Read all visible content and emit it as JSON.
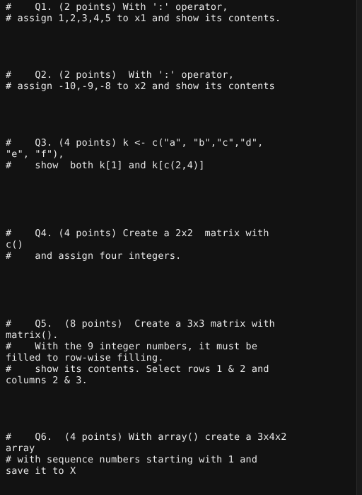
{
  "editor": {
    "background_color": "#121212",
    "text_color": "#e9e9e9",
    "gutter_color": "#1b1b1b"
  },
  "document": {
    "lines": [
      "#    Q1. (2 points) With ':' operator,",
      "# assign 1,2,3,4,5 to x1 and show its contents.",
      "",
      "",
      "",
      "",
      "#    Q2. (2 points)  With ':' operator,",
      "# assign -10,-9,-8 to x2 and show its contents",
      "",
      "",
      "",
      "",
      "#    Q3. (4 points) k <- c(\"a\", \"b\",\"c\",\"d\",",
      "\"e\", \"f\"),",
      "#    show  both k[1] and k[c(2,4)]",
      "",
      "",
      "",
      "",
      "",
      "#    Q4. (4 points) Create a 2x2  matrix with",
      "c()",
      "#    and assign four integers.",
      "",
      "",
      "",
      "",
      "",
      "#    Q5.  (8 points)  Create a 3x3 matrix with",
      "matrix().",
      "#    With the 9 integer numbers, it must be",
      "filled to row-wise filling.",
      "#    show its contents. Select rows 1 & 2 and",
      "columns 2 & 3.",
      "",
      "",
      "",
      "",
      "#    Q6.  (4 points) With array() create a 3x4x2",
      "array",
      "# with sequence numbers starting with 1 and",
      "save it to X"
    ]
  }
}
